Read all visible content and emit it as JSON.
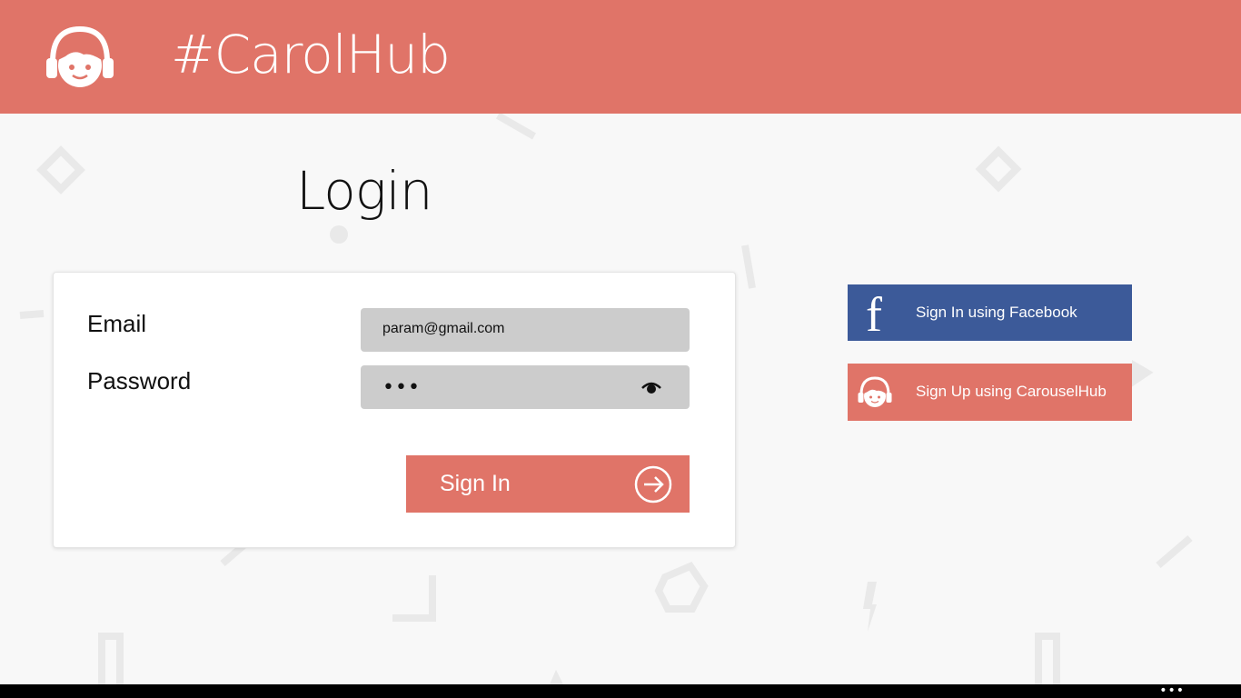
{
  "app": {
    "title": "#CarolHub",
    "logo_icon": "carolhub-logo-icon"
  },
  "login": {
    "heading": "Login",
    "email_label": "Email",
    "email_value": "param@gmail.com",
    "password_label": "Password",
    "password_value": "•••",
    "reveal_icon": "eye-icon",
    "signin_label": "Sign In",
    "signin_icon": "arrow-right-circle-icon"
  },
  "social": {
    "facebook_label": "Sign In using Facebook",
    "facebook_icon": "f",
    "carouselhub_label": "Sign Up using CarouselHub",
    "carouselhub_icon": "carolhub-logo-icon"
  },
  "appbar": {
    "more_icon": "•••"
  },
  "colors": {
    "accent": "#e07468",
    "facebook": "#3c5a99",
    "input_bg": "#cccccc",
    "background": "#f8f8f8"
  }
}
